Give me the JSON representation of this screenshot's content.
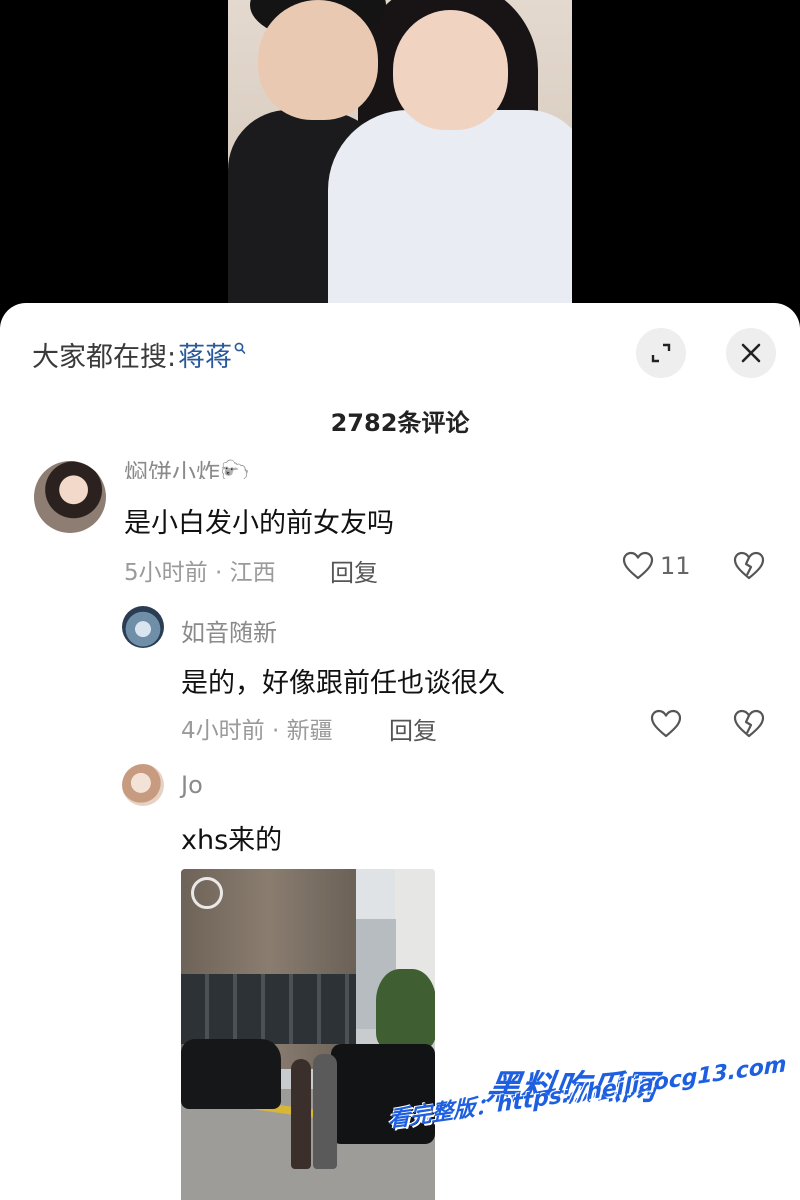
{
  "search_hint": {
    "prefix": "大家都在搜:",
    "term": "蒋蒋"
  },
  "header": {
    "expand_icon": "expand-icon",
    "close_icon": "close-icon"
  },
  "comment_count": "2782条评论",
  "comments": [
    {
      "username": "焖饼小炸🐑",
      "text": "是小白发小的前女友吗",
      "time_location": "5小时前 · 江西",
      "reply_label": "回复",
      "likes": "11"
    },
    {
      "username": "如音随新",
      "text": "是的，好像跟前任也谈很久",
      "time_location": "4小时前 · 新疆",
      "reply_label": "回复",
      "likes": ""
    },
    {
      "username": "Jo",
      "text": "xhs来的"
    }
  ],
  "watermark": {
    "brand": "黑料吃瓜网",
    "url": "看完整版：https://heiliaocg13.com"
  }
}
